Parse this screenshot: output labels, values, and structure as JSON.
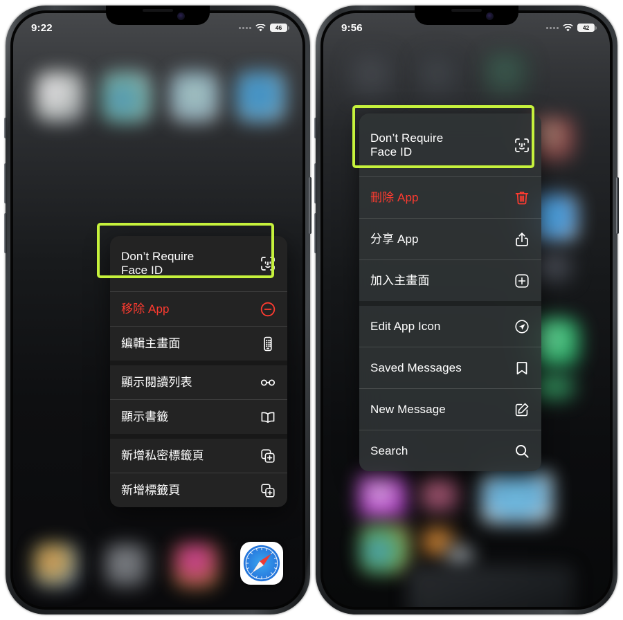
{
  "page": {
    "background": "#ffffff",
    "highlight_color": "#c6f23c"
  },
  "phones": [
    {
      "id": "left-phone",
      "status": {
        "time": "9:22",
        "battery": "46",
        "wifi_icon": "wifi-icon",
        "cellular_icon": "cellular-dots-icon"
      },
      "menu": {
        "name": "safari-context-menu",
        "items": [
          {
            "label": "Don’t Require\nFace ID",
            "icon": "faceid-icon",
            "style": "default",
            "highlighted": true,
            "two_line": true
          },
          {
            "label": "移除 App",
            "icon": "minus-circle-icon",
            "style": "destructive"
          },
          {
            "label": "編輯主畫面",
            "icon": "edit-home-screen-icon",
            "style": "default"
          },
          {
            "label": "顯示閱讀列表",
            "icon": "glasses-icon",
            "style": "default"
          },
          {
            "label": "顯示書籤",
            "icon": "book-icon",
            "style": "default"
          },
          {
            "label": "新增私密標籤頁",
            "icon": "new-private-tab-icon",
            "style": "default"
          },
          {
            "label": "新增標籤頁",
            "icon": "new-tab-icon",
            "style": "default"
          }
        ]
      },
      "dock": {
        "focused_app": "safari-app-icon"
      }
    },
    {
      "id": "right-phone",
      "status": {
        "time": "9:56",
        "battery": "42",
        "wifi_icon": "wifi-icon",
        "cellular_icon": "cellular-dots-icon"
      },
      "menu": {
        "name": "telegram-context-menu",
        "items": [
          {
            "label": "Don’t Require\nFace ID",
            "icon": "faceid-icon",
            "style": "default",
            "highlighted": true,
            "two_line": true
          },
          {
            "label": "刪除 App",
            "icon": "trash-icon",
            "style": "destructive"
          },
          {
            "label": "分享 App",
            "icon": "share-icon",
            "style": "default"
          },
          {
            "label": "加入主畫面",
            "icon": "add-to-home-icon",
            "style": "default"
          },
          {
            "label": "Edit App Icon",
            "icon": "send-icon",
            "style": "default"
          },
          {
            "label": "Saved Messages",
            "icon": "bookmark-icon",
            "style": "default"
          },
          {
            "label": "New Message",
            "icon": "compose-icon",
            "style": "default"
          },
          {
            "label": "Search",
            "icon": "search-icon",
            "style": "default"
          }
        ]
      }
    }
  ]
}
